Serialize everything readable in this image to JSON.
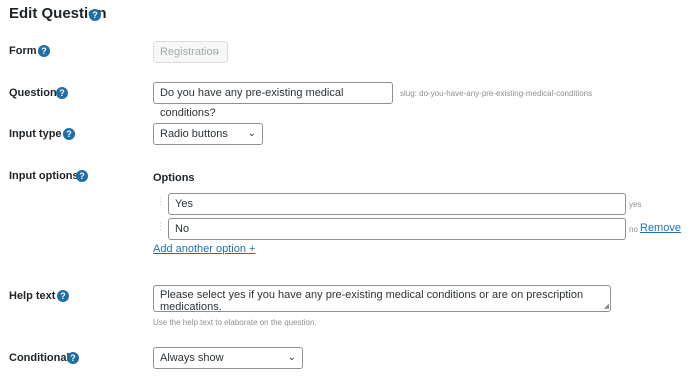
{
  "header": {
    "title": "Edit Question",
    "help": "?"
  },
  "form_field": {
    "label": "Form",
    "value": "Registration"
  },
  "question_field": {
    "label": "Question",
    "value": "Do you have any pre-existing medical conditions?",
    "slug": "slug: do-you-have-any-pre-existing-medical-conditions"
  },
  "input_type": {
    "label": "Input type",
    "value": "Radio buttons"
  },
  "input_options": {
    "label": "Input options",
    "heading": "Options",
    "options": [
      {
        "value": "Yes",
        "slug": "yes"
      },
      {
        "value": "No",
        "slug": "no",
        "remove_label": "Remove"
      }
    ],
    "add_label": "Add another option +"
  },
  "help_text": {
    "label": "Help text",
    "value": "Please select yes if you have any pre-existing medical conditions or are on prescription medications.",
    "hint": "Use the help text to elaborate on the question."
  },
  "conditional": {
    "label": "Conditional",
    "value": "Always show"
  },
  "icons": {
    "help": "question-mark-circle-icon",
    "dropdown": "chevron-down-icon",
    "drag": "drag-handle-icon"
  },
  "colors": {
    "help_icon": "#1e6fa8",
    "link": "#2271b1"
  }
}
